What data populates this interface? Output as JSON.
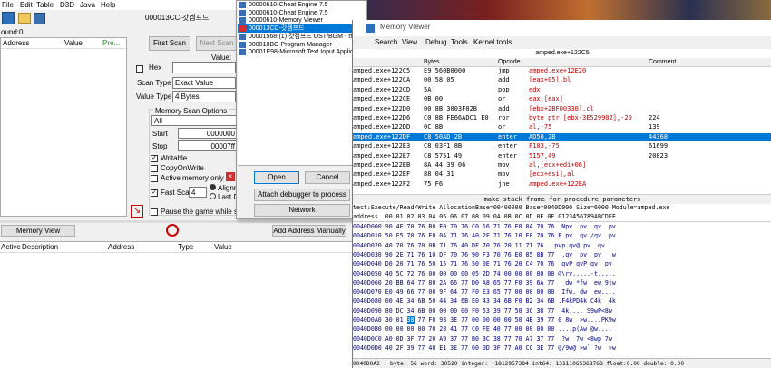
{
  "menubar": [
    "File",
    "Edit",
    "Table",
    "D3D",
    "Java",
    "Help"
  ],
  "main": {
    "process_title": "000013CC-갓겜프드",
    "found": "ound:0",
    "results_cols": [
      "Address",
      "Value",
      "Pre..."
    ],
    "first_scan": "First Scan",
    "next_scan": "Next Scan",
    "value_label": "Value:",
    "hex_label": "Hex",
    "scan_type_label": "Scan Type",
    "scan_type_value": "Exact Value",
    "value_type_label": "Value Type",
    "value_type_value": "4 Bytes",
    "mso_title": "Memory Scan Options",
    "mso_region": "All",
    "start_label": "Start",
    "start_value": "0000000",
    "stop_label": "Stop",
    "stop_value": "00007ff",
    "writable": "Writable",
    "copyonwrite": "CopyOnWrite",
    "active_mem": "Active memory only",
    "fast_scan": "Fast Scan",
    "fast_scan_value": "4",
    "alignment": "Alignm",
    "last_digits": "Last D",
    "pause": "Pause the game while scan",
    "memory_view": "Memory View",
    "add_address": "Add Address Manually",
    "table_cols": [
      "Active",
      "Description",
      "Address",
      "Type",
      "Value"
    ]
  },
  "process_list": {
    "items": [
      "00000610-Cheat Engine 7.5",
      "00000610-Cheat Engine 7.5",
      "00000610-Memory Viewer",
      "000013CC-갓겜프드",
      "00001568-(1) 갓겜프드 OST/BGM - 비",
      "000018BC-Program Manager",
      "00001E98-Microsoft Text Input Applica"
    ],
    "selected_index": 3,
    "open": "Open",
    "cancel": "Cancel",
    "attach": "Attach debugger to process",
    "network": "Network"
  },
  "memview": {
    "title": "Memory Viewer",
    "menu": [
      "Search",
      "View",
      "Debug",
      "Tools",
      "Kernel tools"
    ],
    "address_bar": "amped.exe+122C5",
    "cols": [
      "Bytes",
      "Opcode",
      "Comment"
    ],
    "rows": [
      {
        "addr": "amped.exe+122C5",
        "bytes": "E9 560B0000",
        "op": "jmp",
        "arg": "amped.exe+12E20",
        "cm": ""
      },
      {
        "addr": "amped.exe+122CA",
        "bytes": "00 58 05",
        "op": "add",
        "arg": "[eax+05],bl",
        "cm": ""
      },
      {
        "addr": "amped.exe+122CD",
        "bytes": "5A",
        "op": "pop",
        "arg": "edx",
        "cm": ""
      },
      {
        "addr": "amped.exe+122CE",
        "bytes": "0B 00",
        "op": "or",
        "arg": "eax,[eax]",
        "cm": ""
      },
      {
        "addr": "amped.exe+122D0",
        "bytes": "00 8B 3003F02B",
        "op": "add",
        "arg": "[ebx+2BF00330],cl",
        "cm": ""
      },
      {
        "addr": "amped.exe+122D6",
        "bytes": "C0 8B FE66ADC1 E0",
        "op": "ror",
        "arg": "byte ptr [ebx-3E529902],-20",
        "cm": "224"
      },
      {
        "addr": "amped.exe+122DD",
        "bytes": "0C 8B",
        "op": "or",
        "arg": "al,-75",
        "cm": "139"
      },
      {
        "addr": "amped.exe+122DF",
        "bytes": "C8 50AD 2B",
        "op": "enter",
        "arg": "AD50,2B",
        "cm": "44368"
      },
      {
        "addr": "amped.exe+122E3",
        "bytes": "C8 03F1 8B",
        "op": "enter",
        "arg": "F103,-75",
        "cm": "61699"
      },
      {
        "addr": "amped.exe+122E7",
        "bytes": "C8 5751 49",
        "op": "enter",
        "arg": "5157,49",
        "cm": "20823"
      },
      {
        "addr": "amped.exe+122EB",
        "bytes": "8A 44 39 06",
        "op": "mov",
        "arg": "al,[ecx+edi+06]",
        "cm": ""
      },
      {
        "addr": "amped.exe+122EF",
        "bytes": "88 04 31",
        "op": "mov",
        "arg": "[ecx+esi],al",
        "cm": ""
      },
      {
        "addr": "amped.exe+122F2",
        "bytes": "75 F6",
        "op": "jne",
        "arg": "amped.exe+122EA",
        "cm": ""
      }
    ],
    "selected_row": 7,
    "status": "make stack frame for procedure parameters",
    "hex_info": "tect:Execute/Read/Write  AllocationBase=00400000 Base=0040D000 Size=6000 Module=amped.exe",
    "hex_header": "address  00 01 02 03 04 05 06 07 08 09 0A 0B 0C 0D 0E 0F 0123456789ABCDEF",
    "hex_rows": [
      "0040D000 90 4E 70 76 B0 E0 70 76 C0 16 71 76 E0 8A 70 76  Npv  pv  qv  pv",
      "0040D010 50 F5 70 76 E0 0A 71 76 A0 2F 71 76 10 E0 70 76 P pv  qv /qv  pv",
      "0040D020 40 70 76 70 0B 71 76 40 DF 70 76 20 11 71 76 . pvp qv@ pv  qv",
      "0040D030 90 2E 71 76 10 DF 70 76 90 F3 70 76 E0 85 8B 77  .qv  pv  pv   w",
      "0040D040 D0 20 71 76 50 15 71 76 50 0E 71 76 20 C4 70 76  qvP qvP qv  pv",
      "0040D050 40 5C 72 76 00 00 00 00 05 2D 74 00 00 00 00 00 @\\rv.....-t.....",
      "0040D060 20 BB 64 77 80 2A 66 77 D0 A8 65 77 F0 39 6A 77   dw *fw  ew 9jw",
      "0040D070 E0 49 66 77 00 9F 64 77 F0 E3 65 77 00 00 00 00  Ifw. dw  ew....",
      "0040D080 00 4E 34 6B 50 44 34 6B E0 43 34 6B F0 B2 34 6B .F4kPD4k C4k  4k",
      "0040D090 80 DC 34 6B 00 00 00 00 F0 53 39 77 50 3C 38 77  4k.... S9wP<8w",
      "0040D0A0 30 01 38 77 F0 93 3E 77 00 00 00 00 50 4B 39 77 0 8w  >w....PK9w",
      "0040D0B0 00 00 00 00 70 28 41 77 C0 FE 40 77 00 00 00 00 ....p(Aw @w....",
      "0040D0C0 A0 0D 3F 77 20 A9 37 77 B0 3C 38 77 70 A7 37 77  ?w  7w <8wp 7w",
      "0040D0D0 40 2F 39 77 40 E1 3E 77 60 0D 3F 77 A0 CC 3E 77 @/9w@ >w` ?w  >w"
    ],
    "highlight_byte": "38",
    "footer": "0040D0A2 : byte: 56 word: 30520 integer: -1812957384 int64: 1311106536876B float:0.00 double: 0.00"
  },
  "colors": {
    "selection": "#0078d7",
    "address": "#000080",
    "arg_red": "#c00000",
    "hex_blue": "#000080"
  }
}
